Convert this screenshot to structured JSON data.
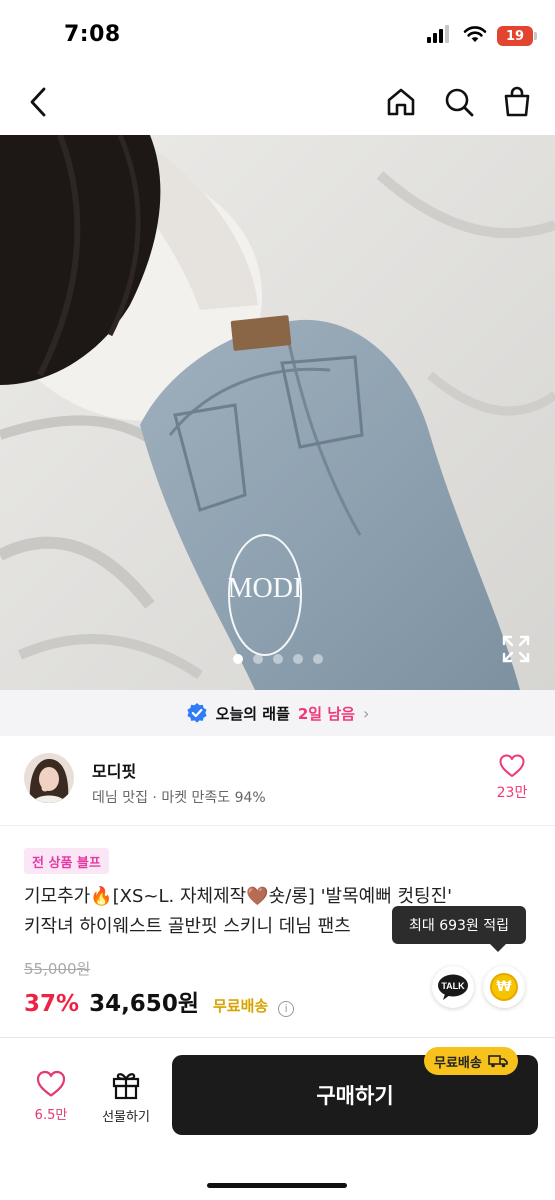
{
  "status_bar": {
    "time": "7:08",
    "battery": "19",
    "icons": [
      "signal-icon",
      "wifi-icon",
      "battery-icon"
    ]
  },
  "nav": {
    "icons": [
      "back-icon",
      "home-icon",
      "search-icon",
      "bag-icon"
    ]
  },
  "gallery": {
    "watermark": "MODI",
    "image_count": 5,
    "active_index": 0
  },
  "raffle": {
    "label": "오늘의 래플",
    "remaining": "2일 남음",
    "chevron": "›"
  },
  "shop": {
    "name": "모디핏",
    "description": "데님 맛집 · 마켓 만족도 94%",
    "like_count": "23만"
  },
  "product": {
    "badge": "전 상품 블프",
    "title_line1": "기모추가🔥[XS~L. 자체제작🤎숏/롱] '발목예뻐 컷팅진'",
    "title_line2": "키작녀 하이웨스트 골반핏 스키니 데님 팬츠",
    "tooltip": "최대 693원 적립",
    "original_price": "55,000원",
    "discount": "37%",
    "price": "34,650원",
    "free_shipping": "무료배송",
    "info_glyph": "i",
    "talk_label": "TALK",
    "won_symbol": "₩"
  },
  "bottom_bar": {
    "like_count": "6.5만",
    "gift_label": "선물하기",
    "buy_label": "구매하기",
    "shipping_pill": "무료배송"
  },
  "colors": {
    "accent_pink": "#f2377b",
    "discount_red": "#ee2244",
    "shipping_yellow": "#f6c21b",
    "buy_button": "#1b1b1b"
  }
}
